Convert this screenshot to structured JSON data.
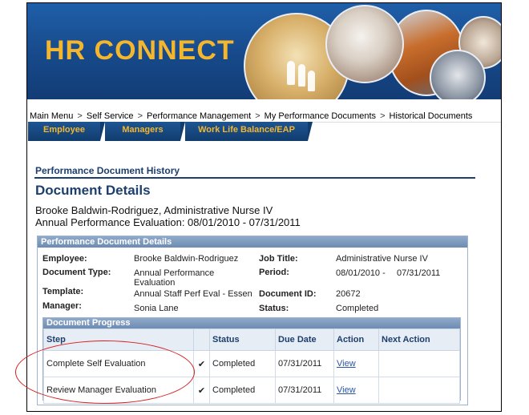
{
  "banner": {
    "title": "HR CONNECT"
  },
  "breadcrumb": {
    "items": [
      "Main Menu",
      "Self Service",
      "Performance Management",
      "My Performance Documents",
      "Historical Documents"
    ],
    "separator": ">"
  },
  "tabs": [
    "Employee",
    "Managers",
    "Work Life Balance/EAP"
  ],
  "page": {
    "history_title": "Performance Document History",
    "title": "Document Details",
    "employee_line": "Brooke Baldwin-Rodriguez, Administrative Nurse IV",
    "evaluation_line": "Annual Performance Evaluation: 08/01/2010 - 07/31/2011"
  },
  "details": {
    "header": "Performance Document Details",
    "employee_label": "Employee:",
    "employee_value": "Brooke Baldwin-Rodriguez",
    "job_title_label": "Job Title:",
    "job_title_value": "Administrative Nurse IV",
    "doc_type_label": "Document Type:",
    "doc_type_value": "Annual Performance Evaluation",
    "period_label": "Period:",
    "period_start": "08/01/2010 -",
    "period_end": "07/31/2011",
    "template_label": "Template:",
    "template_value": "Annual Staff Perf Eval - Essen",
    "document_id_label": "Document ID:",
    "document_id_value": "20672",
    "manager_label": "Manager:",
    "manager_value": "Sonia Lane",
    "status_label": "Status:",
    "status_value": "Completed"
  },
  "progress": {
    "header": "Document Progress",
    "columns": [
      "Step",
      "",
      "Status",
      "Due Date",
      "Action",
      "Next Action"
    ],
    "rows": [
      {
        "step": "Complete Self Evaluation",
        "check": "✔",
        "status": "Completed",
        "due_date": "07/31/2011",
        "action": "View",
        "next_action": ""
      },
      {
        "step": "Review Manager Evaluation",
        "check": "✔",
        "status": "Completed",
        "due_date": "07/31/2011",
        "action": "View",
        "next_action": ""
      }
    ]
  },
  "colors": {
    "banner_blue": "#17498a",
    "banner_gold": "#f4b62c",
    "heading_blue": "#1c3f6e",
    "annotation_red": "#d62020"
  }
}
